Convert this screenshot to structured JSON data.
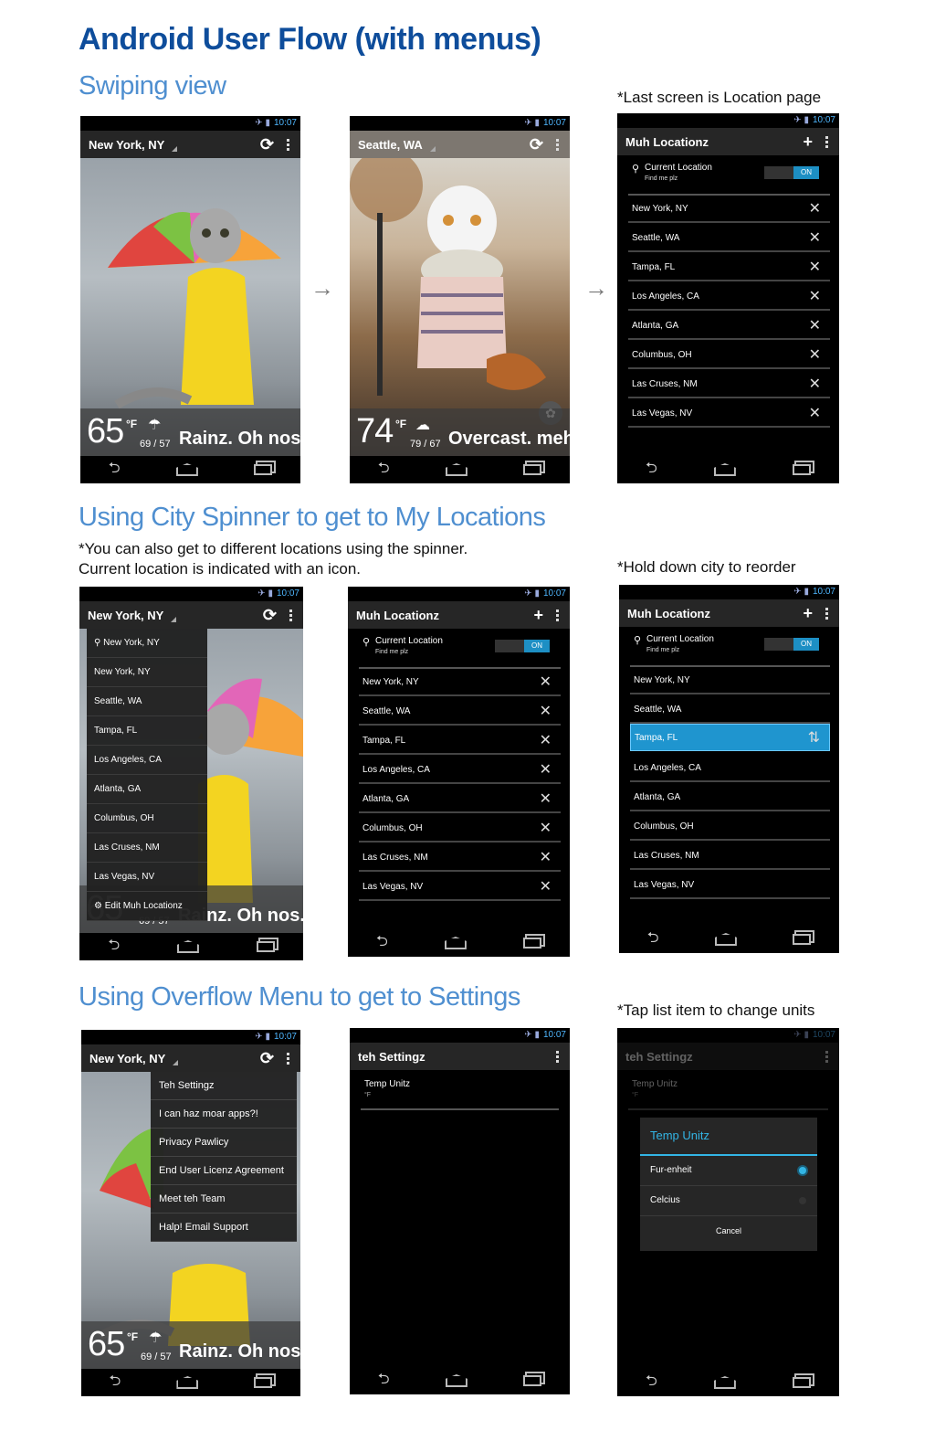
{
  "title": "Android User Flow (with menus)",
  "sections": {
    "swipe": "Swiping view",
    "spinner": "Using City Spinner to get to My Locations",
    "overflow": "Using Overflow Menu to get to Settings"
  },
  "notes": {
    "last_screen": "*Last screen is Location page",
    "spinner_l1": "*You can also get to different locations using the spinner.",
    "spinner_l2": "Current location is indicated with an icon.",
    "reorder": "*Hold down city to reorder",
    "tap_units": "*Tap list item to change units"
  },
  "status": {
    "time": "10:07"
  },
  "screens": {
    "ny": {
      "city": "New York, NY",
      "temp": "65",
      "unit": "°F",
      "hilo": "69 / 57",
      "cond": "Rainz. Oh nos."
    },
    "seattle": {
      "city": "Seattle, WA",
      "temp": "74",
      "unit": "°F",
      "hilo": "79 / 67",
      "cond": "Overcast. meh."
    }
  },
  "locations": {
    "title": "Muh Locationz",
    "current_label": "Current Location",
    "current_sub": "Find me plz",
    "toggle": "ON",
    "cities": [
      "New York, NY",
      "Seattle, WA",
      "Tampa, FL",
      "Los Angeles, CA",
      "Atlanta, GA",
      "Columbus, OH",
      "Las Cruses, NM",
      "Las Vegas, NV"
    ],
    "selected": "Tampa, FL"
  },
  "dropdown": {
    "current": "New York, NY",
    "edit": "Edit Muh Locationz"
  },
  "overflow_menu": [
    "Teh Settingz",
    "I can haz moar apps?!",
    "Privacy Pawlicy",
    "End User Licenz Agreement",
    "Meet teh Team",
    "Halp! Email Support"
  ],
  "settings": {
    "title": "teh Settingz",
    "temp_label": "Temp Unitz",
    "temp_value": "°F"
  },
  "dialog": {
    "title": "Temp Unitz",
    "options": [
      "Fur-enheit",
      "Celcius"
    ],
    "selected": "Fur-enheit",
    "cancel": "Cancel"
  }
}
